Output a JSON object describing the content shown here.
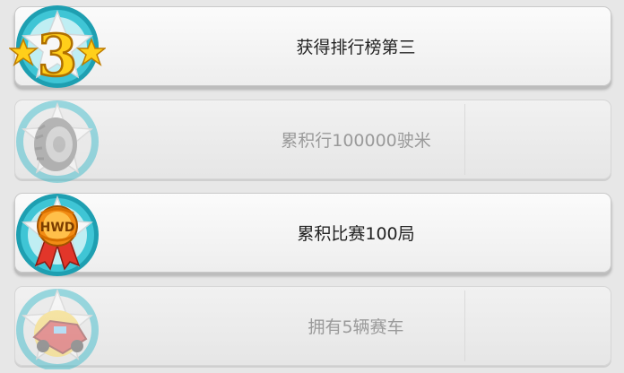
{
  "achievements": [
    {
      "title": "获得排行榜第三",
      "badge_icon": "rank-3-star-icon",
      "badge_number": "3",
      "state": "unlocked"
    },
    {
      "title": "累积行100000驶米",
      "badge_icon": "tire-icon",
      "state": "locked"
    },
    {
      "title": "累积比赛100局",
      "badge_icon": "hwd-medal-icon",
      "badge_text": "HWD",
      "state": "unlocked"
    },
    {
      "title": "拥有5辆赛车",
      "badge_icon": "race-car-icon",
      "state": "locked"
    }
  ],
  "colors": {
    "badge_ring": "#2db7c8",
    "star_gold": "#ffcf1a",
    "medal_orange": "#f28c14",
    "ribbon_red": "#e2362a",
    "car_red": "#d92b2b"
  }
}
